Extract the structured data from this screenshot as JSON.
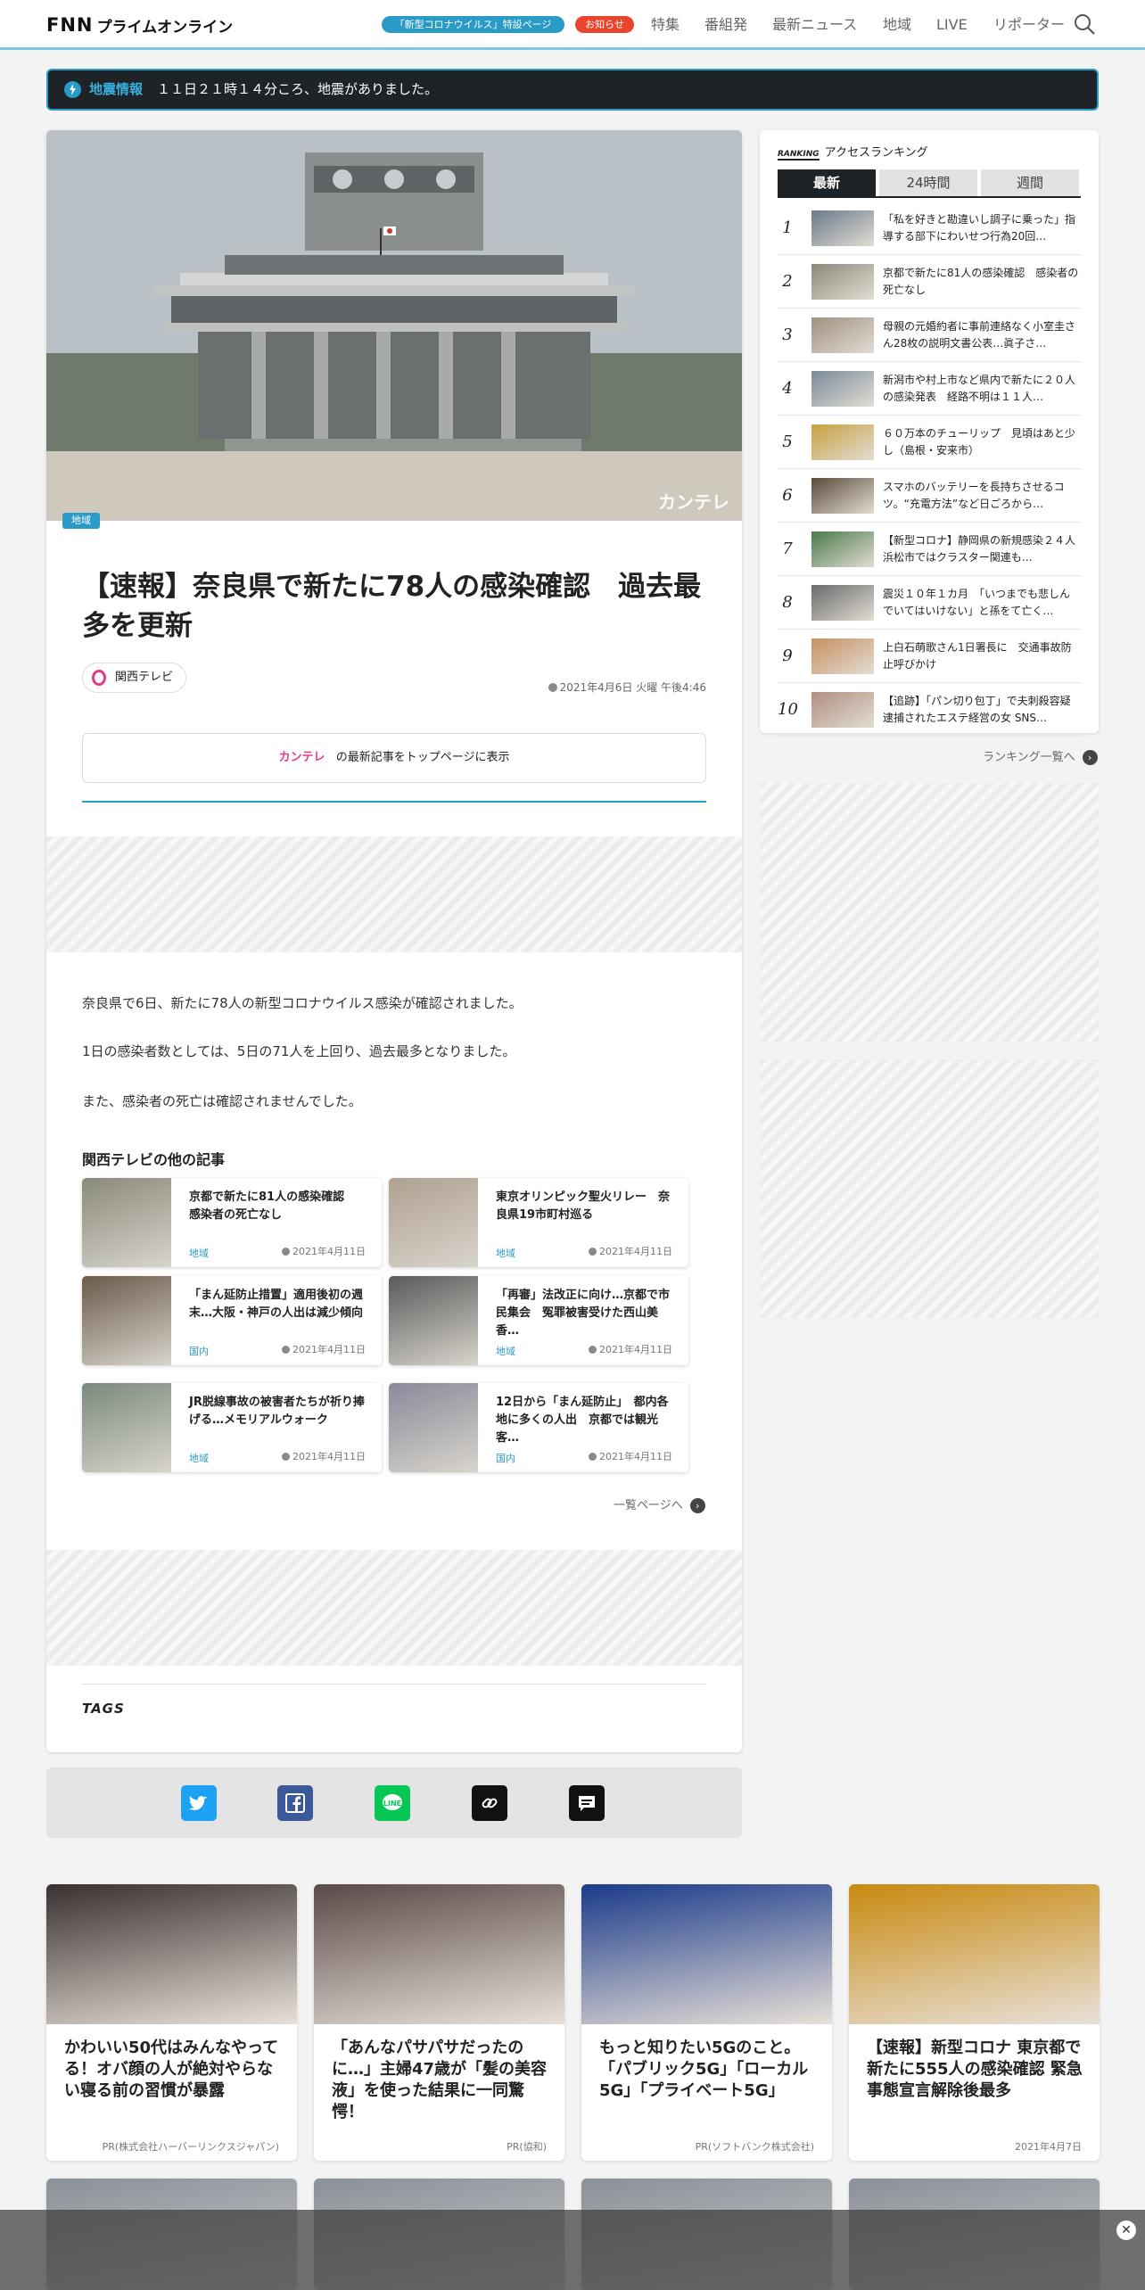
{
  "header": {
    "logo": "FNN",
    "logo_sub": "プライムオンライン",
    "corona_pill": "「新型コロナウイルス」特設ページ",
    "news_pill": "お知らせ",
    "nav": [
      "特集",
      "番組発"
    ]
  },
  "header_nav2": [
    "最新ニュース",
    "地域",
    "LIVE",
    "リポーター"
  ],
  "alert": {
    "label": "地震情報",
    "text": "１１日２１時１４分ころ、地震がありました。"
  },
  "article": {
    "category": "地域",
    "watermark": "カンテレ",
    "title": "【速報】奈良県で新たに78人の感染確認　過去最多を更新",
    "source": "関西テレビ",
    "date": "2021年4月6日 火曜 午後4:46",
    "topbox_logo": "カンテレ",
    "topbox_text": "の最新記事をトップページに表示",
    "paragraphs": [
      "奈良県で6日、新たに78人の新型コロナウイルス感染が確認されました。",
      "1日の感染者数としては、5日の71人を上回り、過去最多となりました。",
      "また、感染者の死亡は確認されませんでした。"
    ],
    "others_heading": "関西テレビの他の記事",
    "others": [
      {
        "title": "京都で新たに81人の感染確認　感染者の死亡なし",
        "cat": "地域",
        "date": "2021年4月11日",
        "color": "#8a8a7a"
      },
      {
        "title": "東京オリンピック聖火リレー　奈良県19市町村巡る",
        "cat": "地域",
        "date": "2021年4月11日",
        "color": "#b0a090"
      },
      {
        "title": "「まん延防止措置」適用後初の週末…大阪・神戸の人出は減少傾向",
        "cat": "国内",
        "date": "2021年4月11日",
        "color": "#6a5a4a"
      },
      {
        "title": "「再審」法改正に向け…京都で市民集会　冤罪被害受けた西山美香…",
        "cat": "地域",
        "date": "2021年4月11日",
        "color": "#5a5a5a"
      },
      {
        "title": "JR脱線事故の被害者たちが祈り捧げる…メモリアルウォーク",
        "cat": "地域",
        "date": "2021年4月11日",
        "color": "#7a8a7a"
      },
      {
        "title": "12日から「まん延防止」　都内各地に多くの人出　京都では観光客…",
        "cat": "国内",
        "date": "2021年4月11日",
        "color": "#8a8a9a"
      }
    ],
    "more_label": "一覧ページへ",
    "tags_label": "TAGS"
  },
  "share": {
    "icons": [
      "twitter-icon",
      "facebook-icon",
      "line-icon",
      "link-icon",
      "comment-icon"
    ],
    "colors": [
      "#1da1f2",
      "#3b5998",
      "#06c755",
      "#111111",
      "#111111"
    ]
  },
  "ranking": {
    "label_small": "RANKING",
    "label": "アクセスランキング",
    "tabs": [
      "最新",
      "24時間",
      "週間"
    ],
    "items": [
      {
        "rank": "1",
        "title": "「私を好きと勘違いし調子に乗った」指導する部下にわいせつ行為20回…",
        "color": "#6a7a8a"
      },
      {
        "rank": "2",
        "title": "京都で新たに81人の感染確認　感染者の死亡なし",
        "color": "#8a8a7a"
      },
      {
        "rank": "3",
        "title": "母親の元婚約者に事前連絡なく小室圭さん28枚の説明文書公表…眞子さ…",
        "color": "#a09080"
      },
      {
        "rank": "4",
        "title": "新潟市や村上市など県内で新たに２０人の感染発表　経路不明は１１人…",
        "color": "#7a8a9a"
      },
      {
        "rank": "5",
        "title": "６０万本のチューリップ　見頃はあと少し（島根・安来市）",
        "color": "#c8a040"
      },
      {
        "rank": "6",
        "title": "スマホのバッテリーを長持ちさせるコツ。“充電方法”など日ごろから…",
        "color": "#5a4a3a"
      },
      {
        "rank": "7",
        "title": "【新型コロナ】静岡県の新規感染２４人　浜松市ではクラスター関連も…",
        "color": "#4a7a4a"
      },
      {
        "rank": "8",
        "title": "震災１０年１カ月　「いつまでも悲しんでいてはいけない」と孫をて亡く…",
        "color": "#6a6a6a"
      },
      {
        "rank": "9",
        "title": "上白石萌歌さん1日署長に　交通事故防止呼びかけ",
        "color": "#c89060"
      },
      {
        "rank": "10",
        "title": "【追跡】「パン切り包丁」で夫刺殺容疑 逮捕されたエステ経営の女 SNS…",
        "color": "#b09080"
      }
    ],
    "more_label": "ランキング一覧へ"
  },
  "grid": [
    {
      "title": "かわいい50代はみんなやってる！オバ顔の人が絶対やらない寝る前の習慣が暴露",
      "meta": "PR(株式会社ハーバーリンクスジャパン)",
      "color": "#3a3030"
    },
    {
      "title": "「あんなパサパサだったのに…」主婦47歳が「髪の美容液」を使った結果に一同驚愕！",
      "meta": "PR(協和)",
      "color": "#5a4a48"
    },
    {
      "title": "もっと知りたい5Gのこと。「パブリック5G」「ローカル5G」「プライベート5G」",
      "meta": "PR(ソフトバンク株式会社)",
      "color": "#1a3a8a"
    },
    {
      "title": "【速報】新型コロナ 東京都で新たに555人の感染確認 緊急事態宣言解除後最多",
      "meta": "2021年4月7日",
      "color": "#c88a10"
    }
  ]
}
